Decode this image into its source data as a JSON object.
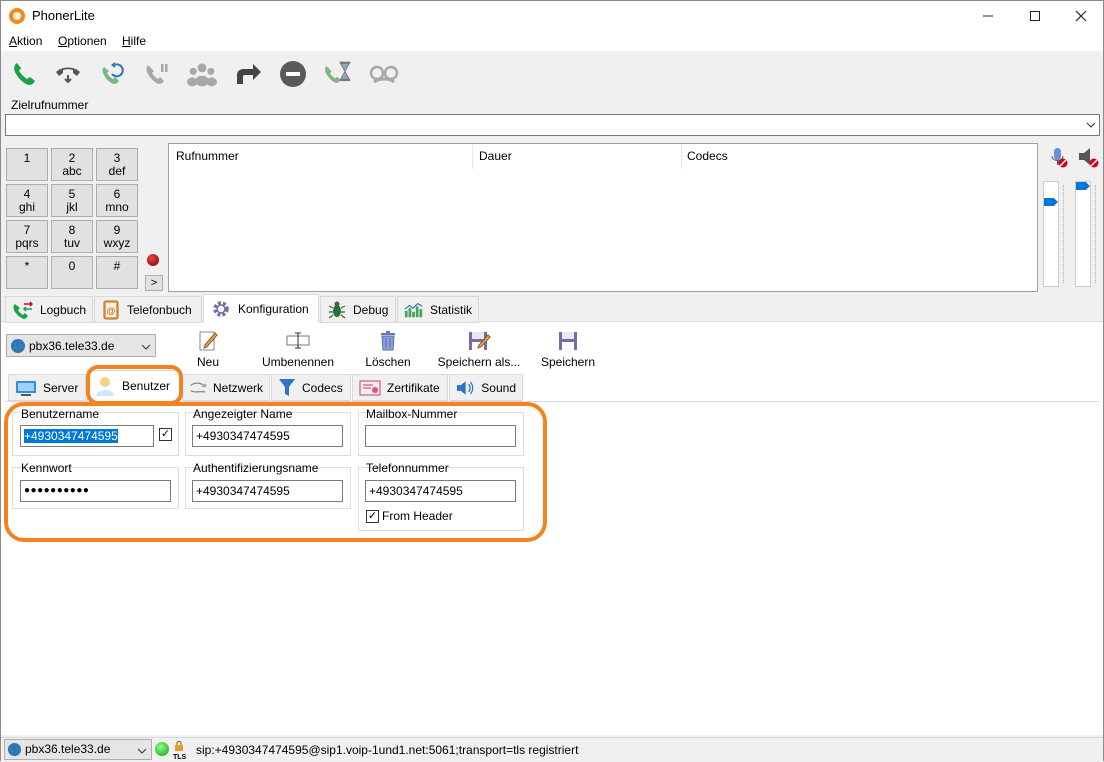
{
  "window": {
    "title": "PhonerLite",
    "minimize_icon": "minimize-icon",
    "maximize_icon": "maximize-icon",
    "close_icon": "close-icon"
  },
  "menu": {
    "items": [
      {
        "first": "A",
        "rest": "ktion"
      },
      {
        "first": "O",
        "rest": "ptionen"
      },
      {
        "first": "H",
        "rest": "ilfe"
      }
    ]
  },
  "toolbar": {
    "icons": [
      "call-icon",
      "hangup-icon",
      "callback-icon",
      "hold-icon",
      "conference-icon",
      "forward-icon",
      "dnd-icon",
      "call-waiting-icon",
      "incognito-icon"
    ]
  },
  "dial": {
    "label": "Zielrufnummer",
    "value": ""
  },
  "keypad": [
    {
      "digit": "1",
      "letters": ""
    },
    {
      "digit": "2",
      "letters": "abc"
    },
    {
      "digit": "3",
      "letters": "def"
    },
    {
      "digit": "4",
      "letters": "ghi"
    },
    {
      "digit": "5",
      "letters": "jkl"
    },
    {
      "digit": "6",
      "letters": "mno"
    },
    {
      "digit": "7",
      "letters": "pqrs"
    },
    {
      "digit": "8",
      "letters": "tuv"
    },
    {
      "digit": "9",
      "letters": "wxyz"
    },
    {
      "digit": "*",
      "letters": ""
    },
    {
      "digit": "0",
      "letters": ""
    },
    {
      "digit": "#",
      "letters": ""
    }
  ],
  "keypad_expand": ">",
  "calls_table": {
    "columns": [
      "Rufnummer",
      "Dauer",
      "Codecs"
    ]
  },
  "main_tabs": [
    "Logbuch",
    "Telefonbuch",
    "Konfiguration",
    "Debug",
    "Statistik"
  ],
  "config": {
    "account": "pbx36.tele33.de",
    "actions": [
      "Neu",
      "Umbenennen",
      "Löschen",
      "Speichern als...",
      "Speichern"
    ],
    "subtabs": [
      "Server",
      "Benutzer",
      "Netzwerk",
      "Codecs",
      "Zertifikate",
      "Sound"
    ],
    "fields": {
      "benutzername": {
        "label": "Benutzername",
        "value": "+4930347474595"
      },
      "angezeigter": {
        "label": "Angezeigter Name",
        "value": "+4930347474595"
      },
      "mailbox": {
        "label": "Mailbox-Nummer",
        "value": ""
      },
      "kennwort": {
        "label": "Kennwort",
        "value": "●●●●●●●●●●"
      },
      "auth": {
        "label": "Authentifizierungsname",
        "value": "+4930347474595"
      },
      "telefon": {
        "label": "Telefonnummer",
        "value": "+4930347474595"
      },
      "from_header": "From Header"
    }
  },
  "status": {
    "account": "pbx36.tele33.de",
    "tls": "TLS",
    "registration": "sip:+4930347474595@sip1.voip-1und1.net:5061;transport=tls registriert"
  },
  "colors": {
    "accent_highlight": "#f5821f",
    "selection": "#0078d7",
    "green": "#1aa346"
  }
}
